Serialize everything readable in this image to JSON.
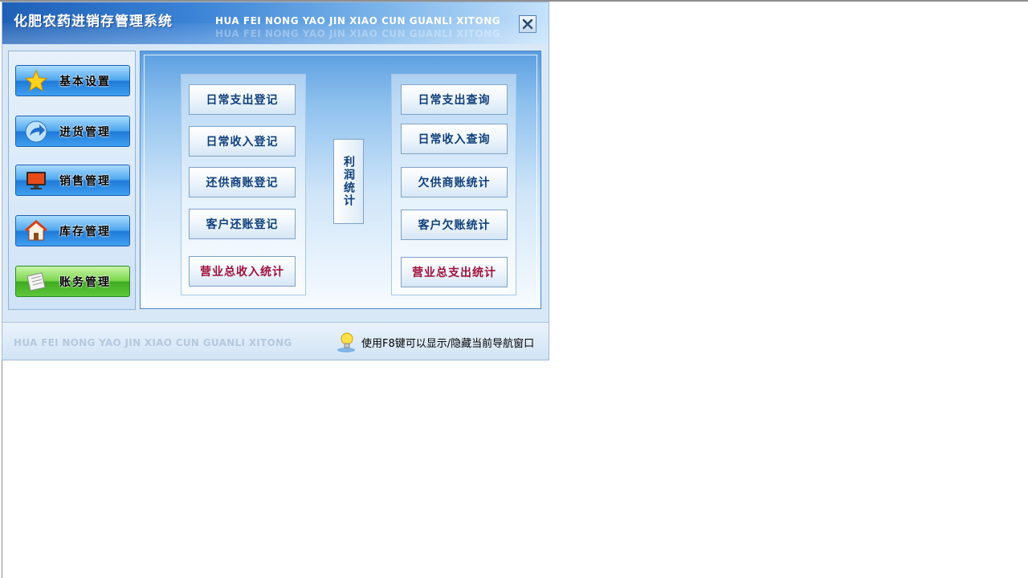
{
  "window": {
    "title_cn": "化肥农药进销存管理系统",
    "title_en": "HUA FEI NONG YAO JIN XIAO CUN GUANLI XITONG",
    "close_icon": "close-icon"
  },
  "nav": {
    "items": [
      {
        "label": "基本设置",
        "icon": "star-icon"
      },
      {
        "label": "进货管理",
        "icon": "arrow-icon"
      },
      {
        "label": "销售管理",
        "icon": "monitor-icon"
      },
      {
        "label": "库存管理",
        "icon": "house-icon"
      },
      {
        "label": "账务管理",
        "icon": "paper-icon"
      }
    ]
  },
  "left_group": {
    "buttons": [
      "日常支出登记",
      "日常收入登记",
      "还供商账登记",
      "客户还账登记",
      "营业总收入统计"
    ]
  },
  "center": {
    "profit_label": "利润统计"
  },
  "right_group": {
    "buttons": [
      "日常支出查询",
      "日常收入查询",
      "欠供商账统计",
      "客户欠账统计",
      "营业总支出统计"
    ]
  },
  "footer": {
    "en_text": "HUA FEI NONG YAO JIN XIAO CUN  GUANLI XITONG",
    "hint": "使用F8键可以显示/隐藏当前导航窗口"
  },
  "colors": {
    "title_start": "#1e60b6",
    "title_end": "#c6e2fb",
    "accent_red": "#a0103a",
    "text_blue": "#0f3f7a"
  }
}
